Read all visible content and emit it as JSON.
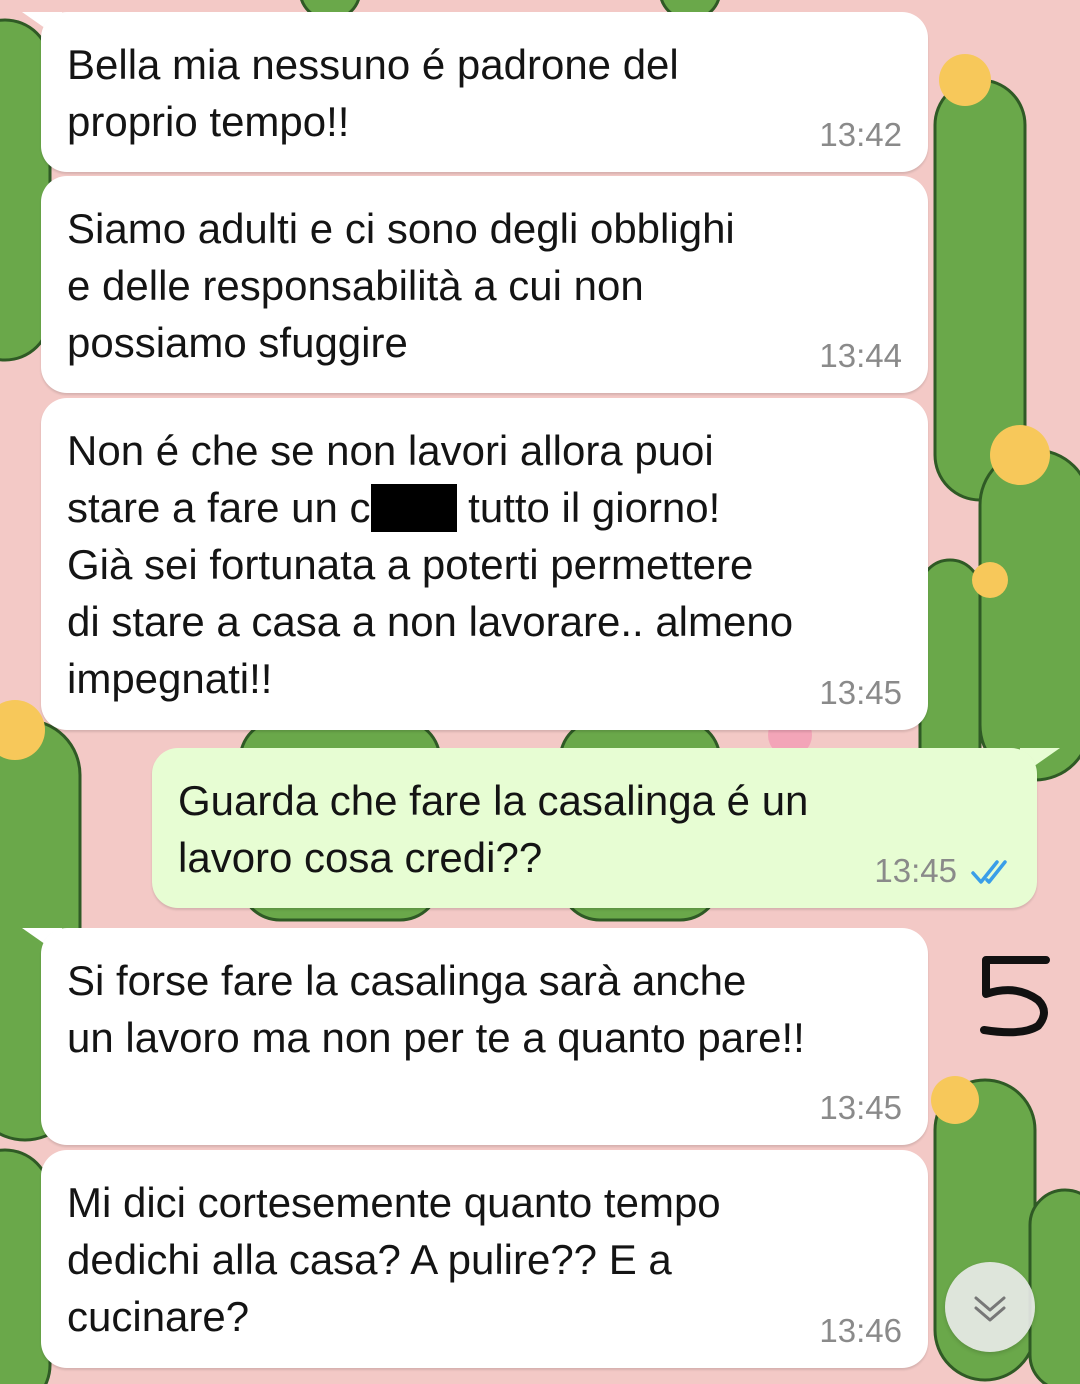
{
  "messages": [
    {
      "direction": "incoming",
      "text": "Bella mia nessuno é padrone del\nproprio tempo!!",
      "time": "13:42"
    },
    {
      "direction": "incoming",
      "text": "Siamo adulti e ci sono degli obblighi\ne delle responsabilità a cui non\npossiamo sfuggire",
      "time": "13:44"
    },
    {
      "direction": "incoming",
      "text_parts": [
        "Non é che se non lavori allora puoi\nstare a fare un c",
        "",
        " tutto il giorno!\nGià sei fortunata a poterti permettere\ndi stare a casa a non lavorare.. almeno\nimpegnati!!"
      ],
      "time": "13:45"
    },
    {
      "direction": "outgoing",
      "text": "Guarda che fare la casalinga é un\nlavoro cosa credi??",
      "time": "13:45",
      "status": "read"
    },
    {
      "direction": "incoming",
      "text": "Si forse fare la casalinga sarà anche\nun lavoro ma non per te a quanto pare!!",
      "time": "13:45"
    },
    {
      "direction": "incoming",
      "text": "Mi dici cortesemente quanto tempo\ndedichi alla casa? A pulire?? E a\ncucinare?",
      "time": "13:46"
    }
  ],
  "overlay": {
    "page_number": "5"
  },
  "colors": {
    "wallpaper": "#f3c9c6",
    "incoming_bubble": "#ffffff",
    "outgoing_bubble": "#e7fdd3",
    "cactus": "#6aa84a",
    "flower": "#f7c85a",
    "read_ticks": "#3a9ee8"
  },
  "icons": {
    "read_receipt": "double-check-icon",
    "scroll_down": "chevron-double-down-icon"
  }
}
